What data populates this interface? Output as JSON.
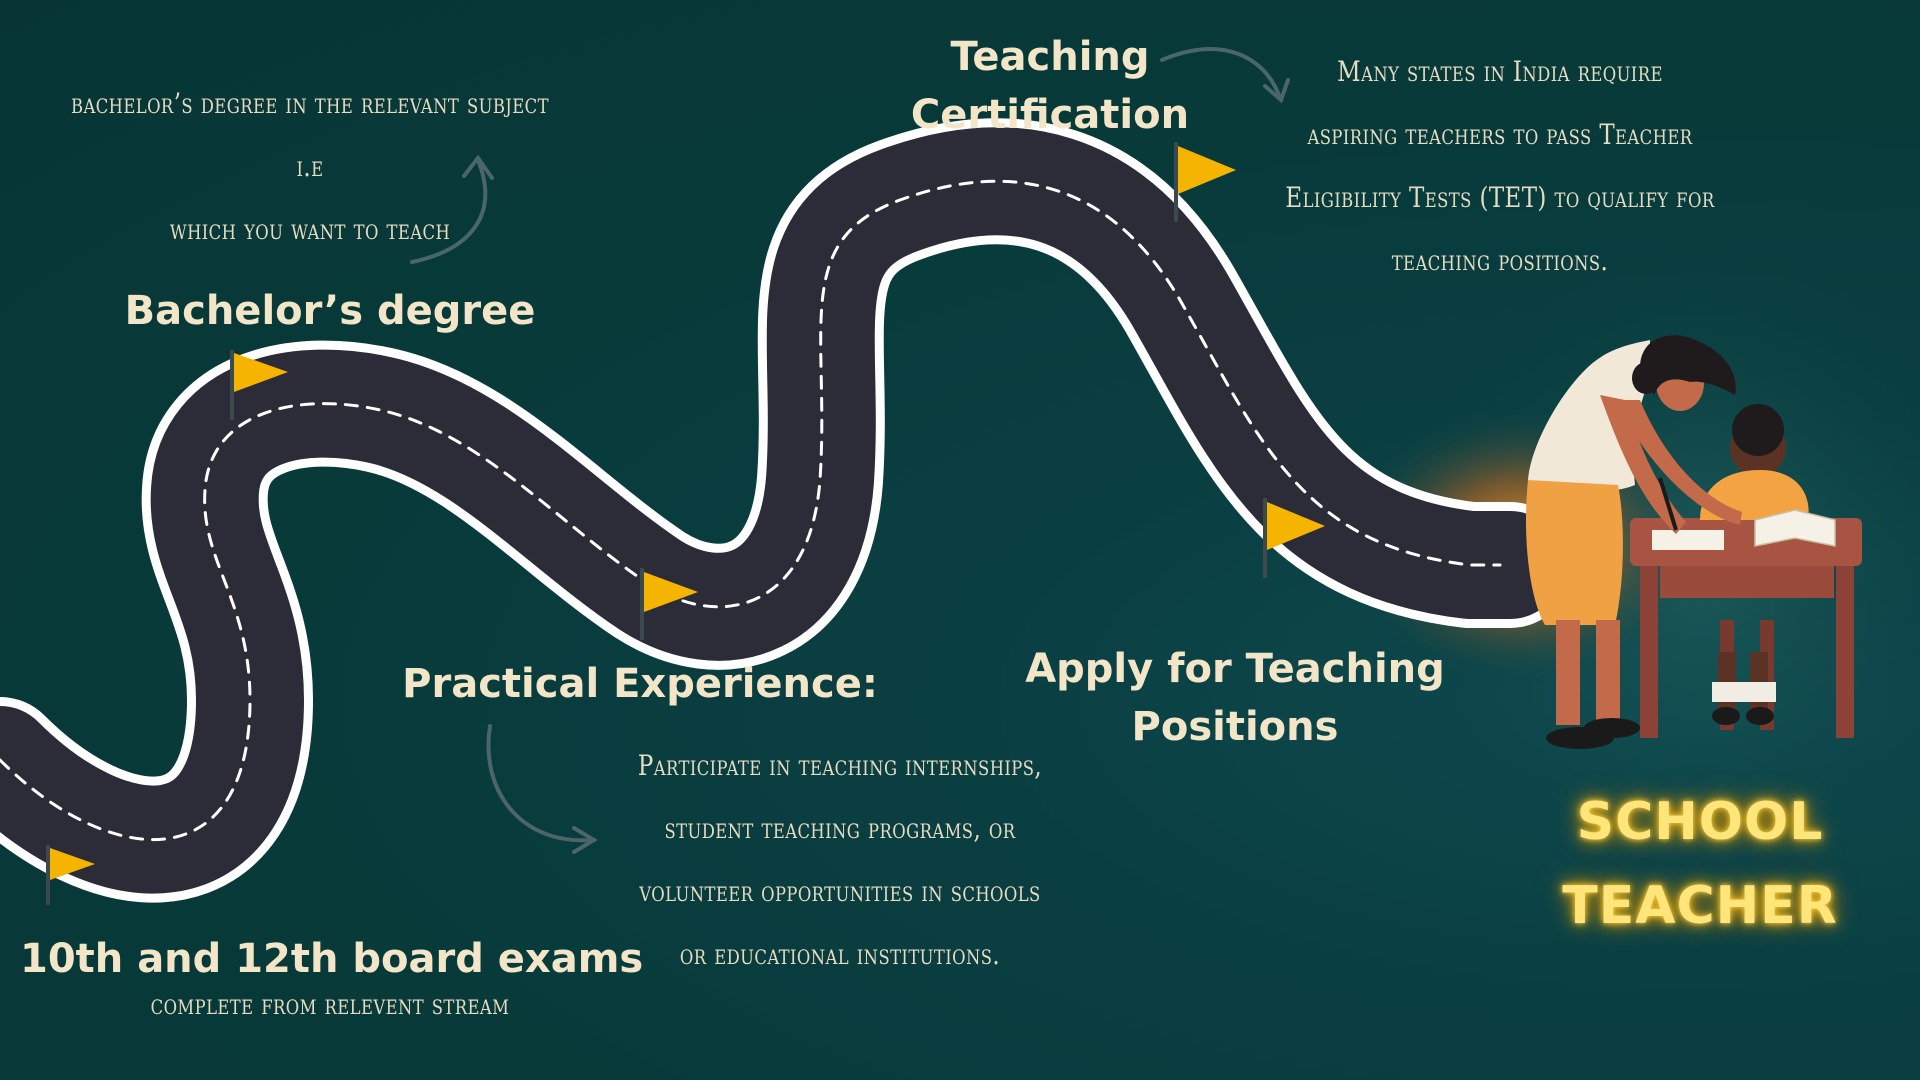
{
  "milestones": {
    "board_exams": {
      "title": "10th and 12th board exams",
      "note": "complete from relevent stream"
    },
    "bachelors": {
      "title": "Bachelor’s degree",
      "note_line1": "bachelor’s degree in the relevant subject i.e",
      "note_line2": "which you want to teach"
    },
    "practical": {
      "title": "Practical Experience:",
      "note_line1": "Participate in teaching internships,",
      "note_line2": "student teaching programs, or",
      "note_line3": "volunteer opportunities in schools",
      "note_line4": "or educational institutions."
    },
    "certification": {
      "title_line1": "Teaching",
      "title_line2": "Certification",
      "note_line1": "Many states in India require",
      "note_line2": "aspiring teachers to pass Teacher",
      "note_line3": "Eligibility Tests (TET) to qualify for",
      "note_line4": "teaching positions."
    },
    "apply": {
      "title_line1": "Apply for Teaching",
      "title_line2": "Positions"
    }
  },
  "goal": {
    "line1": "SCHOOL",
    "line2": "TEACHER"
  },
  "colors": {
    "background": "#073b3c",
    "road": "#2c2b38",
    "road_edge": "#ffffff",
    "flag": "#f4b400",
    "label_text": "#f3e6c8",
    "glow_text": "#ffe57a"
  },
  "icons": [
    "flag-icon",
    "arrow-icon",
    "teacher-illustration"
  ]
}
